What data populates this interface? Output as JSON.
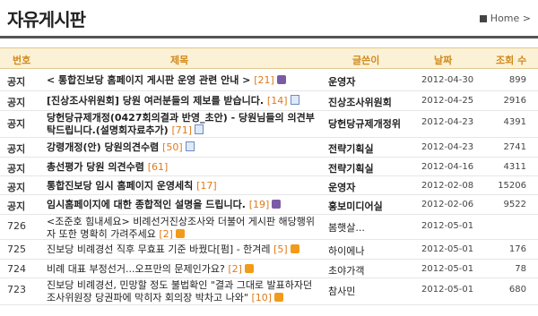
{
  "page": {
    "title": "자유게시판",
    "breadcrumb": "Home >"
  },
  "columns": {
    "num": "번호",
    "subject": "제목",
    "writer": "글쓴이",
    "date": "날짜",
    "hits": "조회 수"
  },
  "rows": [
    {
      "num": "공지",
      "subject": "< 통합진보당 홈페이지 게시판 운영 관련 안내 >",
      "count": "[21]",
      "badge": "u",
      "file": false,
      "writer": "운영자",
      "date": "2012-04-30",
      "hits": "899"
    },
    {
      "num": "공지",
      "subject": "[진상조사위원회] 당원 여러분들의 제보를 받습니다.",
      "count": "[14]",
      "badge": "",
      "file": true,
      "writer": "진상조사위원회",
      "date": "2012-04-25",
      "hits": "2916"
    },
    {
      "num": "공지",
      "subject": "당헌당규제개정(0427회의결과 반영_초안) - 당원님들의 의견부탁드립니다.(설명회자료추가)",
      "count": "[71]",
      "badge": "",
      "file": true,
      "writer": "당헌당규제개정위",
      "date": "2012-04-23",
      "hits": "4391"
    },
    {
      "num": "공지",
      "subject": "강령개정(안) 당원의견수렴",
      "count": "[50]",
      "badge": "",
      "file": true,
      "writer": "전략기획실",
      "date": "2012-04-23",
      "hits": "2741"
    },
    {
      "num": "공지",
      "subject": "총선평가 당원 의견수렴",
      "count": "[61]",
      "badge": "",
      "file": false,
      "writer": "전략기획실",
      "date": "2012-04-16",
      "hits": "4311"
    },
    {
      "num": "공지",
      "subject": "통합진보당 임시 홈페이지 운영세칙",
      "count": "[17]",
      "badge": "",
      "file": false,
      "writer": "운영자",
      "date": "2012-02-08",
      "hits": "15206"
    },
    {
      "num": "공지",
      "subject": "임시홈페이지에 대한 종합적인 설명을 드립니다.",
      "count": "[19]",
      "badge": "u",
      "file": false,
      "writer": "홍보미디어실",
      "date": "2012-02-06",
      "hits": "9522"
    },
    {
      "num": "726",
      "subject": "<조준호 힘내세요> 비례선거진상조사와 더불어 게시판 해당행위자 또한 명확히 가려주세요",
      "count": "[2]",
      "badge": "n",
      "file": false,
      "writer": "봄햇살...",
      "date": "2012-05-01",
      "hits": ""
    },
    {
      "num": "725",
      "subject": "진보당 비례경선 직후 무효표 기준 바꿨다[펌] - 한겨레",
      "count": "[5]",
      "badge": "n",
      "file": false,
      "writer": "하이에나",
      "date": "2012-05-01",
      "hits": "176"
    },
    {
      "num": "724",
      "subject": "비례 대표 부정선거...오프만의 문제인가요?",
      "count": "[2]",
      "badge": "n",
      "file": false,
      "writer": "초야가객",
      "date": "2012-05-01",
      "hits": "78"
    },
    {
      "num": "723",
      "subject": "진보당 비례경선, 민망할 정도 불법확인 \"결과 그대로 발표하자던 조사위원장 당권파에 막히자 회의장 박차고 나와\"",
      "count": "[10]",
      "badge": "n",
      "file": false,
      "writer": "참사민",
      "date": "2012-05-01",
      "hits": "680"
    }
  ]
}
